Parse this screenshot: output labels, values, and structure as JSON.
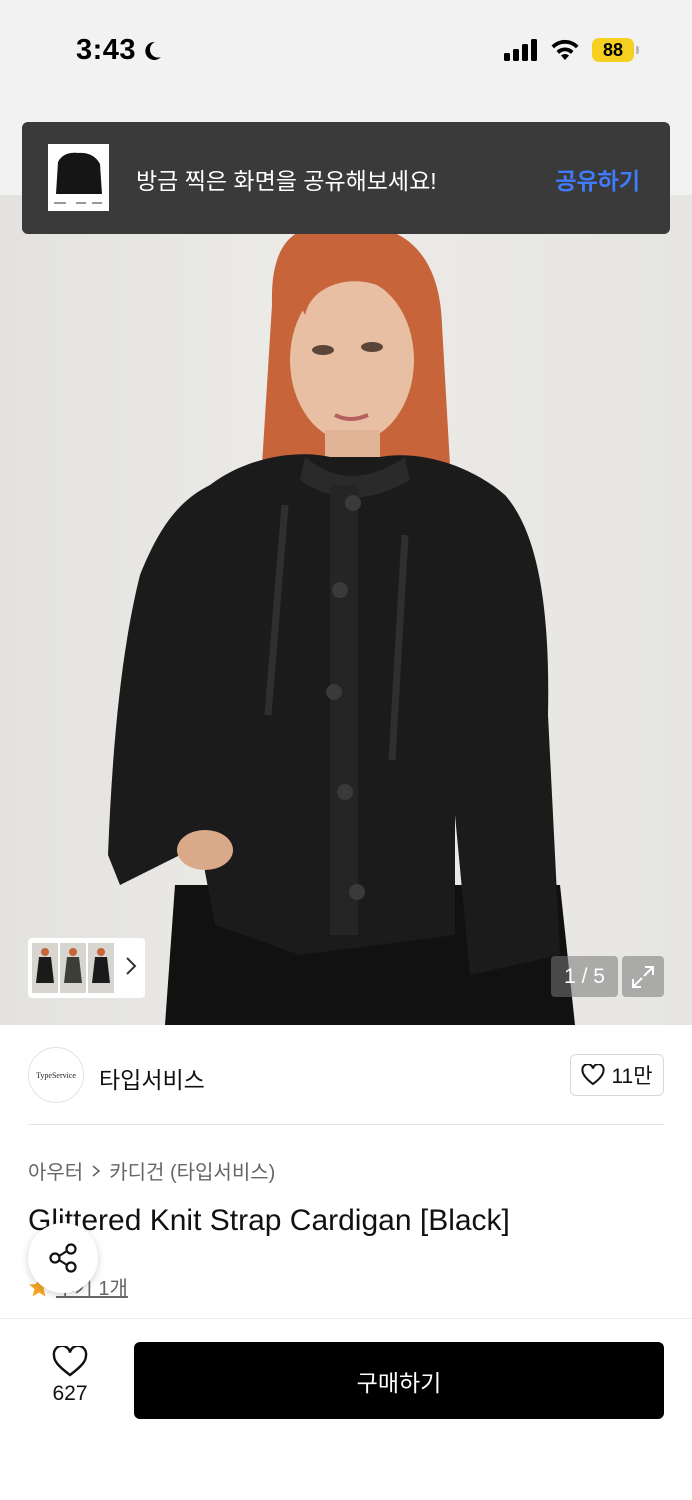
{
  "status_bar": {
    "time": "3:43",
    "battery": "88"
  },
  "toast": {
    "message": "방금 찍은 화면을 공유해보세요!",
    "action": "공유하기"
  },
  "gallery": {
    "counter": "1 / 5"
  },
  "brand": {
    "logo_text": "TypeService",
    "name": "타입서비스",
    "likes": "11만"
  },
  "breadcrumb": {
    "level1": "아우터",
    "level2": "카디건 (타입서비스)"
  },
  "product": {
    "title": "Glittered Knit Strap Cardigan [Black]"
  },
  "rating": {
    "review_label": "후기 1개"
  },
  "bottom_bar": {
    "wish_count": "627",
    "buy_label": "구매하기"
  },
  "colors": {
    "accent": "#3f7cff",
    "toast_bg": "#3a3a3a",
    "buy_bg": "#000000",
    "star": "#f5a623"
  }
}
